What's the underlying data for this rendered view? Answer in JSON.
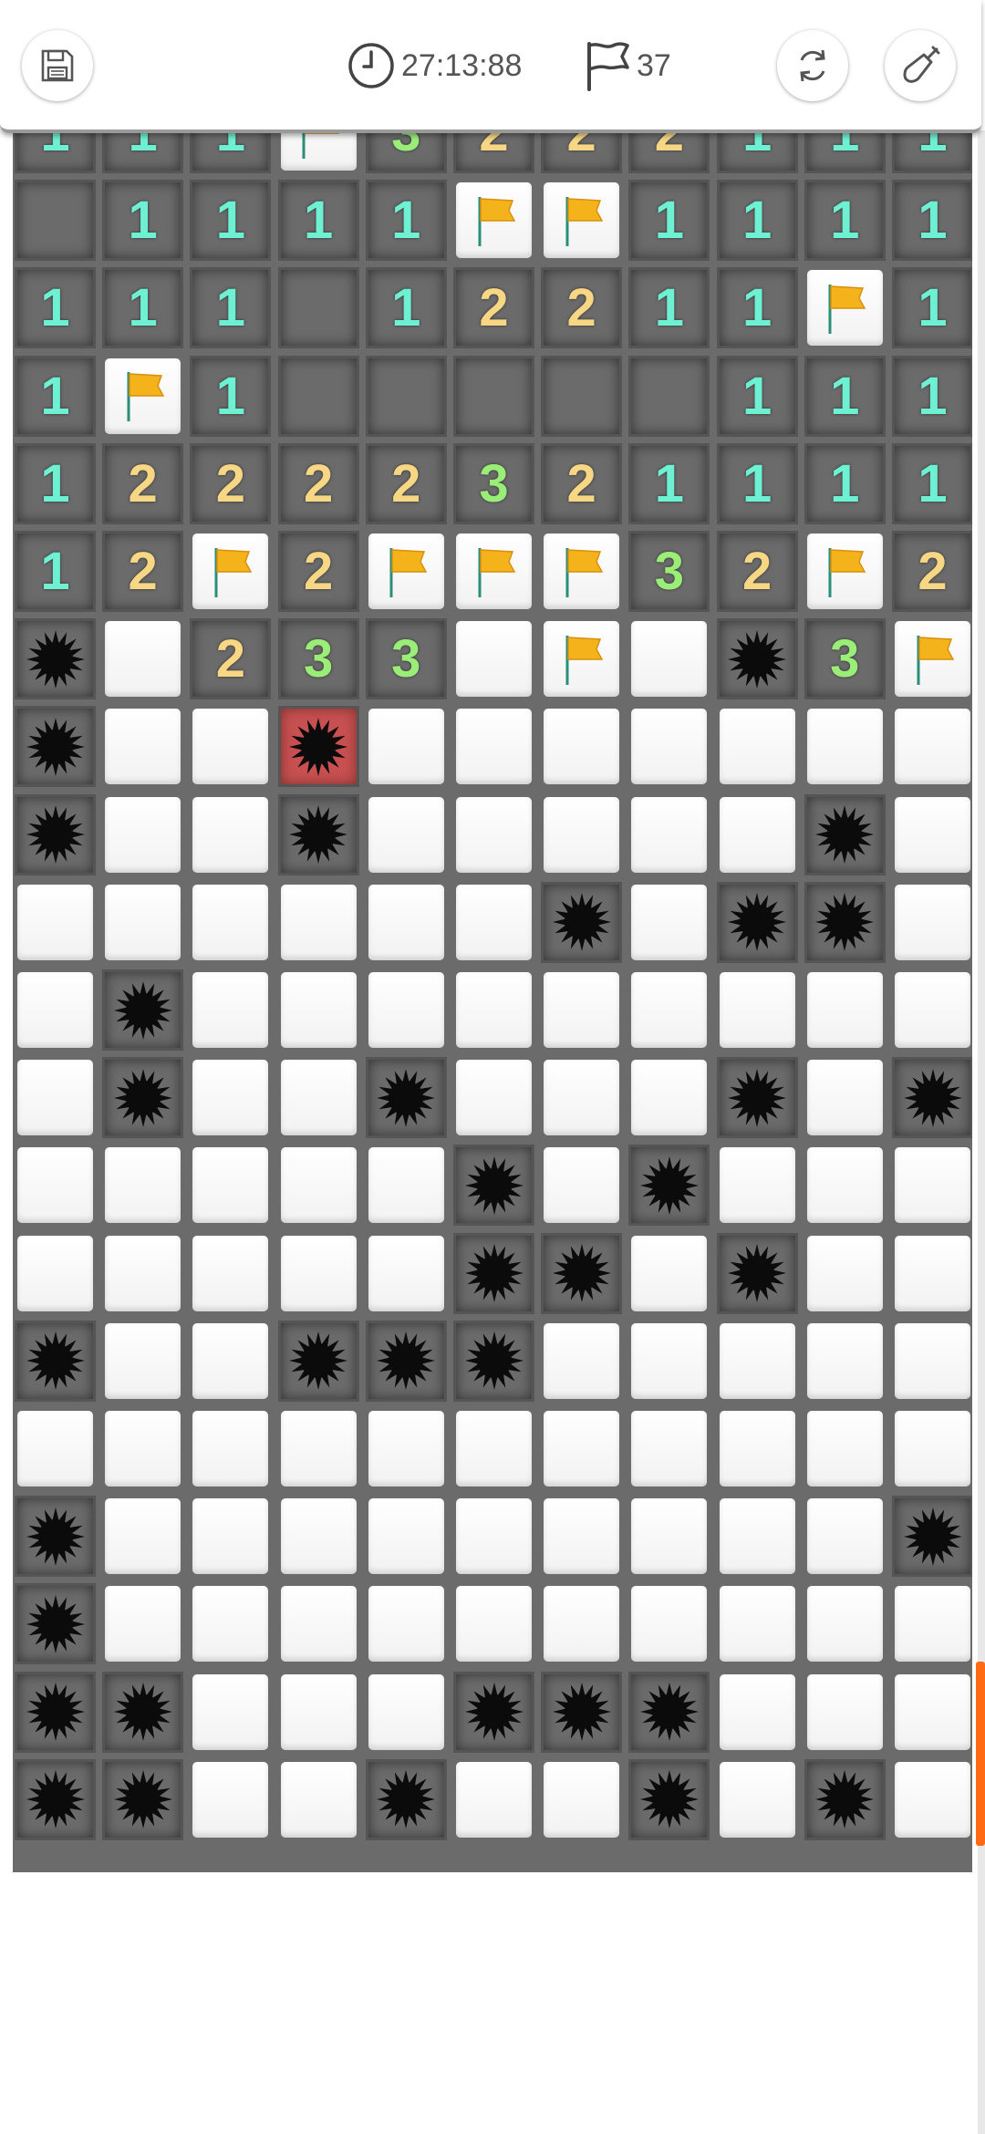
{
  "toolbar": {
    "save_icon": "save-disk-icon",
    "clock_icon": "clock-icon",
    "timer": "27:13:88",
    "flag_icon": "flag-outline-icon",
    "flags_count": "37",
    "restart_icon": "refresh-icon",
    "dig_icon": "shovel-icon"
  },
  "colors": {
    "num1": "#6ef0d2",
    "num2": "#f7d784",
    "num3": "#9aee78",
    "flag": "#f4b21b",
    "exploded": "#c85050",
    "scroll_thumb": "#ff6a13"
  },
  "legend": {
    "H": "hidden",
    "F": "flag",
    "M": "mine",
    "X": "exploded-mine",
    ".": "empty-revealed",
    "1-9": "number"
  },
  "board": {
    "cols": 11,
    "rows": [
      "111F3222111",
      ".1111FF1111",
      "111.12211F1",
      "1F1.....111",
      "12222321111",
      "12F2FFF32F2",
      "MH233HFHM3F",
      "MHHXHHHHHHH",
      "MHHMHHHHHMH",
      "HHHHHHMHMMH",
      "HMHHHHHHHHH",
      "HMHHMHHHMHM",
      "HHHHHMHMHHH",
      "HHHHHMMHMHH",
      "MHHMMMHHHHH",
      "HHHHHHHHHHH",
      "MHHHHHHHHHM",
      "MHHHHHHHHHH",
      "MMHHHMMMHHH",
      "MMHHMHHMHMH"
    ]
  }
}
